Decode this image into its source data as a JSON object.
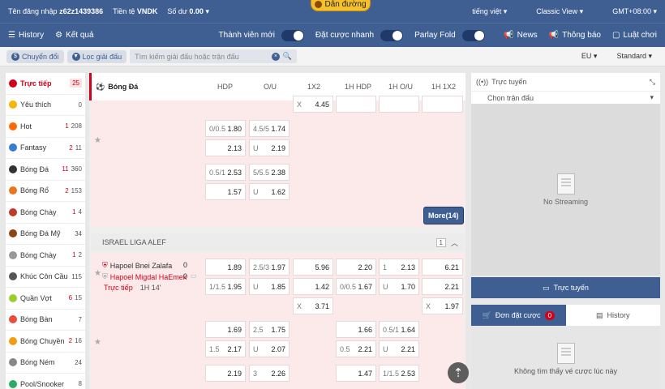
{
  "topbar": {
    "login_label": "Tên đăng nhập",
    "username": "z62z1439386",
    "currency_label": "Tiền tệ",
    "currency": "VNDK",
    "balance_label": "Số dư",
    "balance": "0.00",
    "language": "tiếng việt",
    "view": "Classic View",
    "timezone": "GMT+08:00",
    "guide": "Dẫn đường"
  },
  "navbar": {
    "history": "History",
    "results": "Kết quả",
    "member": "Thành viên mới",
    "quick_bet": "Đặt cược nhanh",
    "parlay": "Parlay Fold",
    "news": "News",
    "notice": "Thông báo",
    "rules": "Luật chơi"
  },
  "filters": {
    "switch": "Chuyển đổi",
    "league_filter": "Lọc giải đấu",
    "search_placeholder": "Tìm kiếm giải đấu hoặc trận đấu",
    "odds_format": "EU",
    "market": "Standard"
  },
  "sidebar": [
    {
      "label": "Trực tiếp",
      "count": "25",
      "live": true,
      "color": "#d0021b"
    },
    {
      "label": "Yêu thích",
      "count": "0",
      "color": "#f5b800"
    },
    {
      "label": "Hot",
      "live_count": "1",
      "count": "208",
      "color": "#ff6a00"
    },
    {
      "label": "Fantasy",
      "live_count": "2",
      "count": "11",
      "color": "#3a7bd5"
    },
    {
      "label": "Bóng Đá",
      "live_count": "11",
      "count": "360",
      "color": "#333"
    },
    {
      "label": "Bóng Rổ",
      "live_count": "2",
      "count": "153",
      "color": "#e87722"
    },
    {
      "label": "Bóng Chày",
      "live_count": "1",
      "count": "4",
      "color": "#c0392b"
    },
    {
      "label": "Bóng Đá Mỹ",
      "count": "34",
      "color": "#8b4513"
    },
    {
      "label": "Bóng Chày",
      "live_count": "1",
      "count": "2",
      "color": "#999"
    },
    {
      "label": "Khúc Côn Cầu",
      "count": "115",
      "color": "#555"
    },
    {
      "label": "Quần Vợt",
      "live_count": "6",
      "count": "15",
      "color": "#9acd32"
    },
    {
      "label": "Bóng Bàn",
      "count": "7",
      "color": "#e74c3c"
    },
    {
      "label": "Bóng Chuyền",
      "live_count": "2",
      "count": "16",
      "color": "#f39c12"
    },
    {
      "label": "Bóng Ném",
      "count": "24",
      "color": "#888"
    },
    {
      "label": "Pool/Snooker",
      "count": "8",
      "color": "#27ae60"
    }
  ],
  "table": {
    "sport": "Bóng Đá",
    "headers": [
      "HDP",
      "O/U",
      "1X2",
      "1H HDP",
      "1H O/U",
      "1H 1X2"
    ]
  },
  "block1": {
    "top_row": {
      "hdp": "X",
      "odd": "4.45"
    },
    "rows": [
      {
        "h1": "0/0.5",
        "o1": "1.80",
        "h2": "4.5/5",
        "o2": "1.74"
      },
      {
        "h1": "",
        "o1": "2.13",
        "h2": "U",
        "o2": "2.19"
      },
      {
        "h1": "0.5/1",
        "o1": "2.53",
        "h2": "5/5.5",
        "o2": "2.38"
      },
      {
        "h1": "",
        "o1": "1.57",
        "h2": "U",
        "o2": "1.62"
      }
    ],
    "more_label": "More",
    "more_count": "(14)"
  },
  "league": {
    "name": "ISRAEL LIGA ALEF",
    "count": "1"
  },
  "match": {
    "home": "Hapoel Bnei Zalafa",
    "home_score": "0",
    "away": "Hapoel Migdal HaEmek",
    "away_score": "0",
    "live": "Trực tiếp",
    "time": "1H 14'",
    "rows1": [
      [
        "",
        "1.89",
        "2.5/3",
        "1.97",
        "",
        "5.96",
        "",
        "2.20",
        "1",
        "2.13",
        "",
        "6.21"
      ],
      [
        "1/1.5",
        "1.95",
        "U",
        "1.85",
        "",
        "1.42",
        "0/0.5",
        "1.67",
        "U",
        "1.70",
        "",
        "2.21"
      ],
      [
        "",
        "",
        "",
        "",
        "X",
        "3.71",
        "",
        "",
        "",
        "",
        "X",
        "1.97"
      ]
    ],
    "rows2": [
      [
        "",
        "1.69",
        "2.5",
        "1.75",
        "",
        "",
        "",
        "1.66",
        "0.5/1",
        "1.64"
      ],
      [
        "1.5",
        "2.17",
        "U",
        "2.07",
        "",
        "",
        "0.5",
        "2.21",
        "U",
        "2.21"
      ]
    ],
    "rows3": [
      [
        "",
        "2.19",
        "3",
        "2.26",
        "",
        "",
        "",
        "1.47",
        "1/1.5",
        "2.53"
      ]
    ]
  },
  "right": {
    "live_title": "Trực tuyến",
    "choose_match": "Chọn trận đấu",
    "no_streaming": "No Streaming",
    "stream_button": "Trực tuyến",
    "bet_tab": "Đơn đặt cược",
    "bet_count": "0",
    "history_tab": "History",
    "no_bets": "Không tìm thấy vé cược lúc này"
  }
}
